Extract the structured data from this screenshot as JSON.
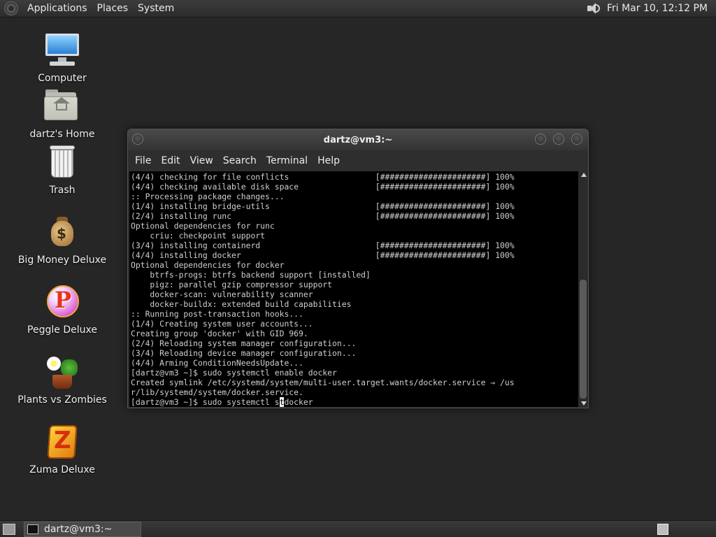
{
  "top_panel": {
    "menus": [
      "Applications",
      "Places",
      "System"
    ],
    "clock": "Fri Mar 10, 12:12 PM"
  },
  "desktop": {
    "icons": [
      {
        "label": "Computer",
        "icon": "computer-icon"
      },
      {
        "label": "dartz's Home",
        "icon": "home-folder-icon"
      },
      {
        "label": "Trash",
        "icon": "trash-icon"
      },
      {
        "label": "Big Money Deluxe",
        "icon": "money-bag-icon"
      },
      {
        "label": "Peggle Deluxe",
        "icon": "peggle-icon"
      },
      {
        "label": "Plants vs Zombies",
        "icon": "plants-vs-zombies-icon"
      },
      {
        "label": "Zuma Deluxe",
        "icon": "zuma-icon"
      }
    ]
  },
  "terminal": {
    "title": "dartz@vm3:~",
    "menus": [
      "File",
      "Edit",
      "View",
      "Search",
      "Terminal",
      "Help"
    ],
    "lines": [
      "(4/4) checking for file conflicts                  [######################] 100%",
      "(4/4) checking available disk space                [######################] 100%",
      ":: Processing package changes...",
      "(1/4) installing bridge-utils                      [######################] 100%",
      "(2/4) installing runc                              [######################] 100%",
      "Optional dependencies for runc",
      "    criu: checkpoint support",
      "(3/4) installing containerd                        [######################] 100%",
      "(4/4) installing docker                            [######################] 100%",
      "Optional dependencies for docker",
      "    btrfs-progs: btrfs backend support [installed]",
      "    pigz: parallel gzip compressor support",
      "    docker-scan: vulnerability scanner",
      "    docker-buildx: extended build capabilities",
      ":: Running post-transaction hooks...",
      "(1/4) Creating system user accounts...",
      "Creating group 'docker' with GID 969.",
      "(2/4) Reloading system manager configuration...",
      "(3/4) Reloading device manager configuration...",
      "(4/4) Arming ConditionNeedsUpdate...",
      "[dartz@vm3 ~]$ sudo systemctl enable docker",
      "Created symlink /etc/systemd/system/multi-user.target.wants/docker.service → /us",
      "r/lib/systemd/system/docker.service."
    ],
    "prompt_before_cursor": "[dartz@vm3 ~]$ sudo systemctl s",
    "cursor_char": "t",
    "prompt_after_cursor": "docker"
  },
  "bottom_panel": {
    "task_label": "dartz@vm3:~"
  }
}
